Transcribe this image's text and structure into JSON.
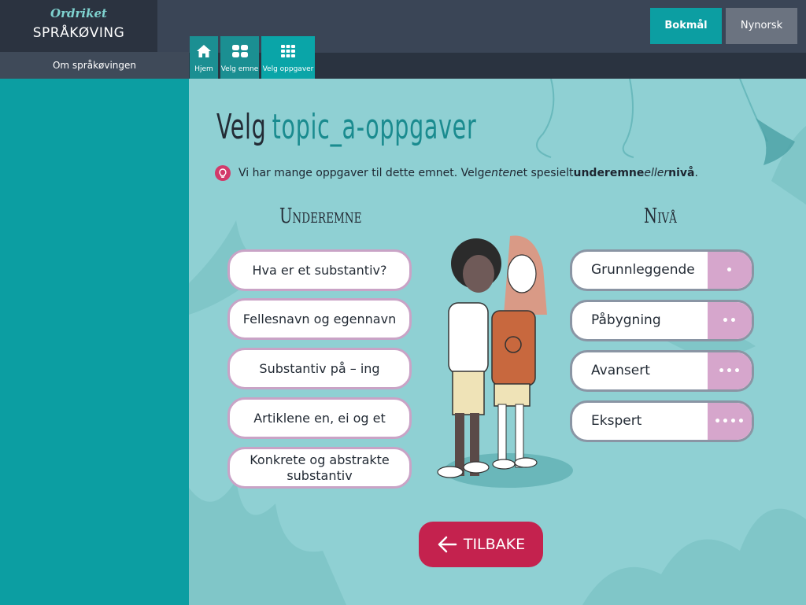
{
  "sidebar": {
    "logo": "Ordriket",
    "title": "SPRÅKØVING",
    "about": "Om språkøvingen"
  },
  "language": {
    "bokmal": "Bokmål",
    "nynorsk": "Nynorsk"
  },
  "tabs": [
    {
      "label": "Hjem",
      "icon": "home-icon"
    },
    {
      "label": "Velg emne",
      "icon": "grid-4-icon"
    },
    {
      "label": "Velg oppgaver",
      "icon": "grid-9-icon"
    }
  ],
  "heading": {
    "prefix": "Velg",
    "topic": "topic_a-oppgaver"
  },
  "hint": {
    "icon": "lightbulb-icon",
    "part1": "Vi har mange oppgaver til dette emnet. Velg ",
    "em1": "enten",
    "part2": " et spesielt ",
    "strong1": "underemne",
    "part3": " ",
    "em2": "eller",
    "part4": " ",
    "strong2": "nivå",
    "part5": "."
  },
  "subtopics": {
    "heading": "Underemne",
    "items": [
      "Hva er et substantiv?",
      "Fellesnavn og egennavn",
      "Substantiv på – ing",
      "Artiklene en, ei og et",
      "Konkrete og abstrakte substantiv"
    ]
  },
  "levels": {
    "heading": "Nivå",
    "items": [
      {
        "label": "Grunnleggende",
        "dots": "•"
      },
      {
        "label": "Påbygning",
        "dots": "••"
      },
      {
        "label": "Avansert",
        "dots": "•••"
      },
      {
        "label": "Ekspert",
        "dots": "••••"
      }
    ]
  },
  "back_label": "TILBAKE",
  "colors": {
    "teal": "#0c9ea2",
    "accent": "#c4224e",
    "pink": "#d6a6cc",
    "dark": "#2b3340"
  }
}
